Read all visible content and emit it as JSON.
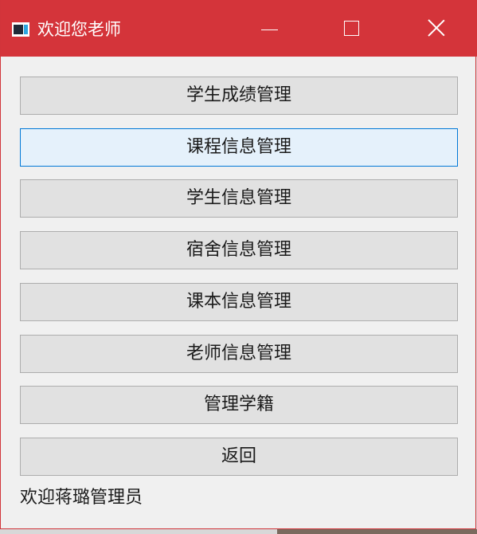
{
  "window": {
    "title": "欢迎您老师",
    "titlebar_color": "#d4343a",
    "controls": {
      "minimize": "minimize-icon",
      "maximize": "maximize-icon",
      "close": "close-icon"
    }
  },
  "menu": {
    "buttons": [
      {
        "label": "学生成绩管理",
        "focused": false
      },
      {
        "label": "课程信息管理",
        "focused": true
      },
      {
        "label": "学生信息管理",
        "focused": false
      },
      {
        "label": "宿舍信息管理",
        "focused": false
      },
      {
        "label": "课本信息管理",
        "focused": false
      },
      {
        "label": "老师信息管理",
        "focused": false
      },
      {
        "label": "管理学籍",
        "focused": false
      },
      {
        "label": "返回",
        "focused": false
      }
    ]
  },
  "status": {
    "welcome_text": "欢迎蒋璐管理员"
  }
}
